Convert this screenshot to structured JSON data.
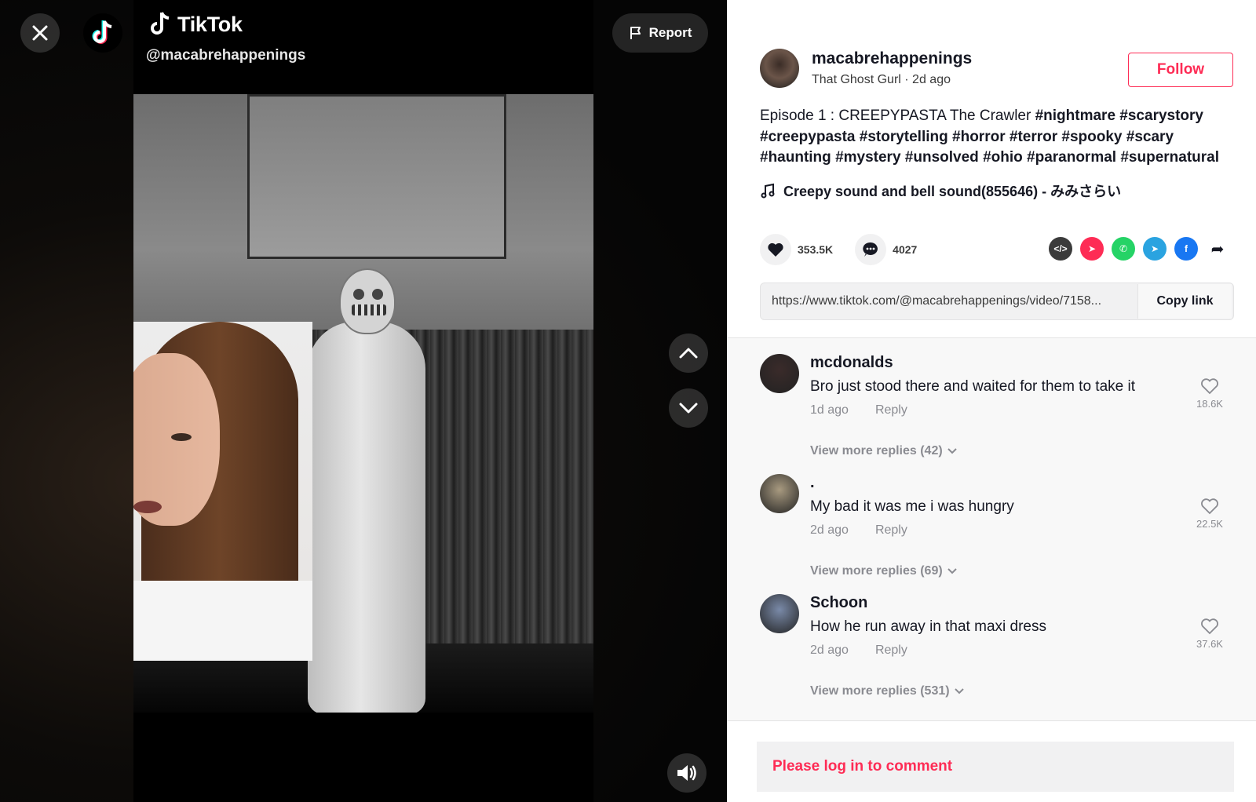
{
  "video": {
    "brand_name": "TikTok",
    "handle": "@macabrehappenings",
    "report_label": "Report"
  },
  "author": {
    "username": "macabrehappenings",
    "nickname": "That Ghost Gurl",
    "separator": " · ",
    "posted": "2d ago",
    "follow_label": "Follow"
  },
  "caption": {
    "text": "Episode 1 : CREEPYPASTA The Crawler ",
    "tags": [
      "#nightmare",
      "#scarystory",
      "#creepypasta",
      "#storytelling",
      "#horror",
      "#terror",
      "#spooky",
      "#scary",
      "#haunting",
      "#mystery",
      "#unsolved",
      "#ohio",
      "#paranormal",
      "#supernatural"
    ]
  },
  "music": {
    "title": "Creepy sound and bell sound(855646) - みみさらい"
  },
  "stats": {
    "likes": "353.5K",
    "comments": "4027"
  },
  "share": {
    "items": [
      {
        "name": "embed",
        "color": "#3b3b3b",
        "glyph": "</>"
      },
      {
        "name": "send-to-friends",
        "color": "#fe2c55",
        "glyph": "➤"
      },
      {
        "name": "whatsapp",
        "color": "#25d366",
        "glyph": "✆"
      },
      {
        "name": "telegram",
        "color": "#2aa3e0",
        "glyph": "➤"
      },
      {
        "name": "facebook",
        "color": "#1877f2",
        "glyph": "f"
      }
    ]
  },
  "link": {
    "url": "https://www.tiktok.com/@macabrehappenings/video/7158...",
    "copy_label": "Copy link"
  },
  "comments": [
    {
      "user": "mcdonalds",
      "text": "Bro just stood there and waited for them to take it",
      "time": "1d ago",
      "reply_label": "Reply",
      "likes": "18.6K",
      "more": "View more replies (42)",
      "avatar_color": "#3a2b2a"
    },
    {
      "user": ".",
      "text": "My bad it was me i was hungry",
      "time": "2d ago",
      "reply_label": "Reply",
      "likes": "22.5K",
      "more": "View more replies (69)",
      "avatar_color": "#a89a80"
    },
    {
      "user": "Schoon",
      "text": "How he run away in that maxi dress",
      "time": "2d ago",
      "reply_label": "Reply",
      "likes": "37.6K",
      "more": "View more replies (531)",
      "avatar_color": "#7a8aa8"
    }
  ],
  "login_prompt": "Please log in to comment"
}
